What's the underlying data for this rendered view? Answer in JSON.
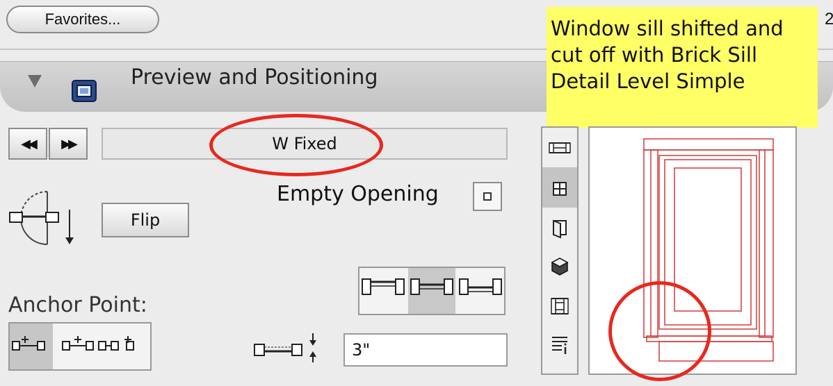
{
  "toolbar": {
    "favorites_label": "Favorites...",
    "edge_glyph": "2"
  },
  "annotation": {
    "note_text": "Window sill shifted and cut off with Brick Sill Detail Level Simple",
    "colors": {
      "note_bg": "#ffff66",
      "highlight_ring": "#e8281e"
    }
  },
  "section": {
    "title": "Preview and Positioning",
    "expanded": true
  },
  "library": {
    "prev_icon": "◀◀",
    "next_icon": "▶▶",
    "object_name": "W Fixed"
  },
  "opening": {
    "empty_opening_label": "Empty Opening",
    "flip_label": "Flip"
  },
  "anchor": {
    "label": "Anchor Point:",
    "offset_value": "3\""
  },
  "view_tabs": [
    "floor-plan-view",
    "elevation-view",
    "section-view",
    "3d-view",
    "detail-view",
    "list-view"
  ],
  "colors": {
    "preview_lines": "#d23a3a",
    "panel_bg": "#ececec"
  }
}
